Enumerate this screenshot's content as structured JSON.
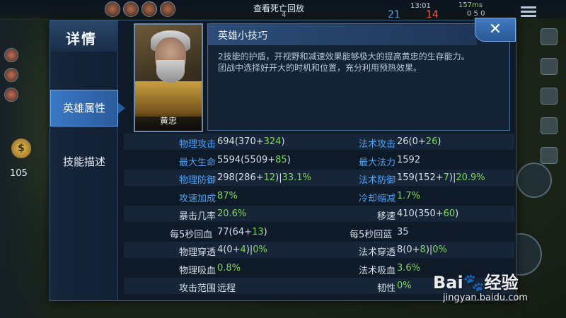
{
  "hud": {
    "title": "查看死亡回放",
    "kills": "4",
    "time": "13:01",
    "score_blue": "21",
    "score_red": "14",
    "ping": "157ms",
    "stats_line": "0  5  0",
    "gold": "105"
  },
  "dialog": {
    "title": "详情",
    "close_label": "✕",
    "tabs": [
      {
        "label": "英雄属性",
        "active": true
      },
      {
        "label": "技能描述",
        "active": false
      }
    ],
    "hero_name": "黄忠",
    "tip": {
      "title": "英雄小技巧",
      "line1": "2技能的护盾，开视野和减速效果能够极大的提高黄忠的生存能力。",
      "line2": "团战中选择好开大的时机和位置，充分利用预热效果。"
    }
  },
  "stats": {
    "left": [
      {
        "label": "物理攻击",
        "base": "694",
        "detail": "(370+324)",
        "extra": ""
      },
      {
        "label": "最大生命",
        "base": "5594",
        "detail": "(5509+85)",
        "extra": ""
      },
      {
        "label": "物理防御",
        "base": "298",
        "detail": "(286+12)",
        "extra": "33.1%"
      },
      {
        "label": "攻速加成",
        "base": "87%",
        "detail": "",
        "extra": ""
      },
      {
        "label": "暴击几率",
        "base": "20.6%",
        "detail": "",
        "extra": ""
      },
      {
        "label": "每5秒回血",
        "base": "77",
        "detail": "(64+13)",
        "extra": ""
      },
      {
        "label": "物理穿透",
        "base": "4",
        "detail": "(0+4)",
        "extra": "0%"
      },
      {
        "label": "物理吸血",
        "base": "0.8%",
        "detail": "",
        "extra": ""
      },
      {
        "label": "攻击范围",
        "base": "远程",
        "detail": "",
        "extra": ""
      }
    ],
    "right": [
      {
        "label": "法术攻击",
        "base": "26",
        "detail": "(0+26)",
        "extra": ""
      },
      {
        "label": "最大法力",
        "base": "1592",
        "detail": "",
        "extra": ""
      },
      {
        "label": "法术防御",
        "base": "159",
        "detail": "(152+7)",
        "extra": "20.9%"
      },
      {
        "label": "冷却缩减",
        "base": "1.7%",
        "detail": "",
        "extra": ""
      },
      {
        "label": "移速",
        "base": "410",
        "detail": "(350+60)",
        "extra": ""
      },
      {
        "label": "每5秒回蓝",
        "base": "35",
        "detail": "",
        "extra": ""
      },
      {
        "label": "法术穿透",
        "base": "8",
        "detail": "(0+8)",
        "extra": "0%"
      },
      {
        "label": "法术吸血",
        "base": "3.6%",
        "detail": "",
        "extra": ""
      },
      {
        "label": "韧性",
        "base": "0%",
        "detail": "",
        "extra": ""
      }
    ]
  },
  "watermark": {
    "logo": "Bai🐾经验",
    "url": "jingyan.baidu.com"
  },
  "colors": {
    "accent_blue": "#4fa0f0",
    "bonus_green": "#7ed957",
    "panel_bg": "#0f1a29"
  }
}
